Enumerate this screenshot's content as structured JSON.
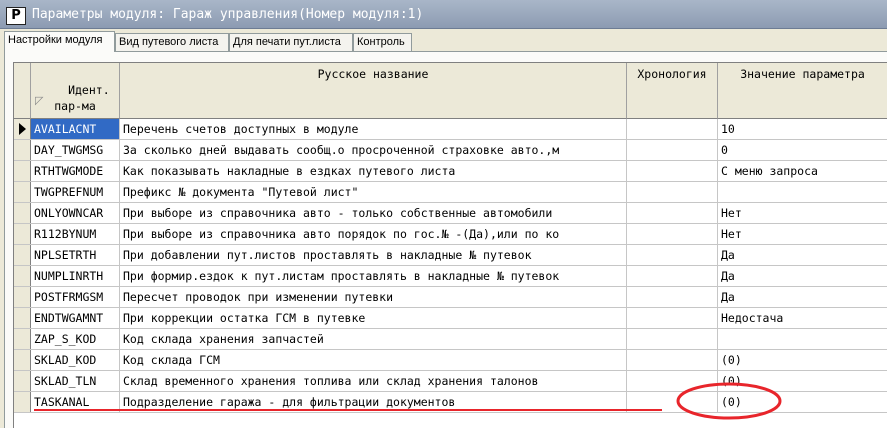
{
  "window": {
    "title": "Параметры модуля: Гараж управления(Номер модуля:1)",
    "icon_letter": "P"
  },
  "tabs": [
    {
      "label": "Настройки модуля",
      "active": true
    },
    {
      "label": "Вид путевого листа",
      "active": false
    },
    {
      "label": "Для печати пут.листа",
      "active": false
    },
    {
      "label": "Контроль",
      "active": false
    }
  ],
  "grid": {
    "columns": {
      "id": "Идент.\nпар-ма",
      "name": "Русское название",
      "history": "Хронология",
      "value": "Значение параметра"
    },
    "rows": [
      {
        "id": "AVAILACNT",
        "name": "Перечень счетов доступных в модуле",
        "history": "",
        "value": "10",
        "current": true
      },
      {
        "id": "DAY_TWGMSG",
        "name": "За сколько дней выдавать сообщ.о просроченной страховке авто.,м",
        "history": "",
        "value": "0",
        "current": false
      },
      {
        "id": "RTHTWGMODE",
        "name": "Как показывать накладные в ездках путевого листа",
        "history": "",
        "value": "С меню запроса",
        "current": false
      },
      {
        "id": "TWGPREFNUM",
        "name": "Префикс № документа \"Путевой лист\"",
        "history": "",
        "value": "",
        "current": false
      },
      {
        "id": "ONLYOWNCAR",
        "name": "При выборе из справочника авто - только собственные автомобили",
        "history": "",
        "value": "Нет",
        "current": false
      },
      {
        "id": "R112BYNUM",
        "name": "При выборе из справочника авто порядок по гос.№ -(Да),или по ко",
        "history": "",
        "value": "Нет",
        "current": false
      },
      {
        "id": "NPLSETRTH",
        "name": "При добавлении пут.листов проставлять в накладные № путевок",
        "history": "",
        "value": "Да",
        "current": false
      },
      {
        "id": "NUMPLINRTH",
        "name": "При формир.ездок к пут.листам проставлять в накладные № путевок",
        "history": "",
        "value": "Да",
        "current": false
      },
      {
        "id": "POSTFRMGSM",
        "name": "Пересчет проводок при изменении путевки",
        "history": "",
        "value": "Да",
        "current": false
      },
      {
        "id": "ENDTWGAMNT",
        "name": "При коррекции остатка ГСМ в путевке",
        "history": "",
        "value": "Недостача",
        "current": false
      },
      {
        "id": "ZAP_S_KOD",
        "name": "Код склада хранения запчастей",
        "history": "",
        "value": "",
        "current": false
      },
      {
        "id": "SKLAD_KOD",
        "name": "Код склада ГСМ",
        "history": "",
        "value": "(0)",
        "current": false
      },
      {
        "id": "SKLAD_TLN",
        "name": "Склад временного хранения топлива или склад хранения талонов",
        "history": "",
        "value": "(0)",
        "current": false
      },
      {
        "id": "TASKANAL",
        "name": "Подразделение гаража - для фильтрации документов",
        "history": "",
        "value": "(0)",
        "current": false
      }
    ]
  },
  "annotation": {
    "color": "#e8252b"
  }
}
